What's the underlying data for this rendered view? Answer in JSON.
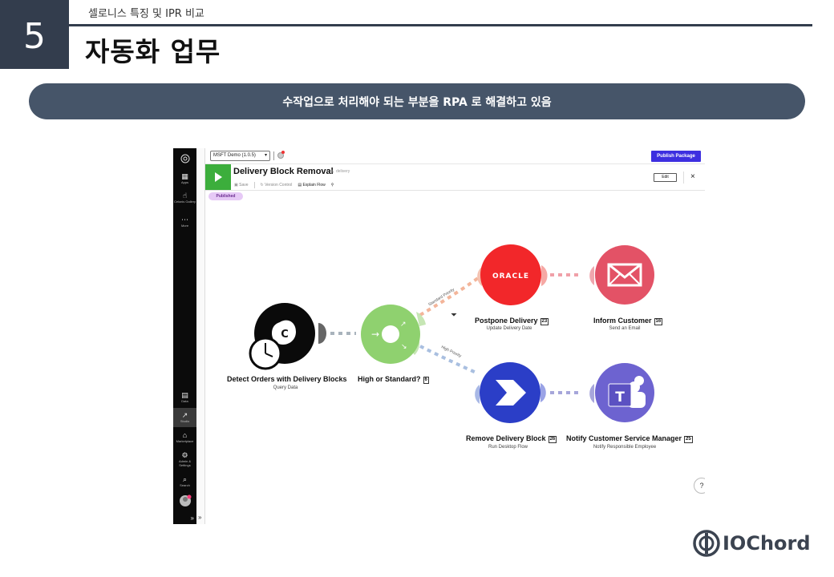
{
  "header": {
    "section_number": "5",
    "section_label": "셀로니스 특징 및 IPR 비교",
    "title": "자동화 업무"
  },
  "banner": {
    "text": "수작업으로 처리해야 되는 부분을 RPA 로 해결하고 있음"
  },
  "screenshot": {
    "sidebar": {
      "items": [
        {
          "icon": "apps-icon",
          "label": "Apps"
        },
        {
          "icon": "celonis-gallery-icon",
          "label": "Celonis Gallery"
        },
        {
          "icon": "more-icon",
          "label": "More"
        },
        {
          "icon": "data-icon",
          "label": "Data"
        },
        {
          "icon": "studio-icon",
          "label": "Studio"
        },
        {
          "icon": "marketplace-icon",
          "label": "Marketplace"
        },
        {
          "icon": "admin-settings-icon",
          "label": "Admin & Settings"
        },
        {
          "icon": "search-icon",
          "label": "Search"
        }
      ],
      "expand_glyph": "»"
    },
    "topbar": {
      "env_select": "MSFT Demo (1.0.5)",
      "publish_label": "Publish Package"
    },
    "flow": {
      "title": "Delivery Block Removal",
      "subtitle": "delivery",
      "toolbar": {
        "save": "Save",
        "version_control": "Version Control",
        "explain_flow": "Explain Flow"
      },
      "edit_label": "Edit",
      "close_glyph": "×",
      "status_badge": "Published"
    },
    "nodes": {
      "detect": {
        "title": "Detect Orders with Delivery Blocks",
        "subtitle": "Query Data",
        "glyph": "C"
      },
      "router": {
        "title": "High or Standard?",
        "badge": "6"
      },
      "postpone": {
        "title": "Postpone Delivery",
        "badge": "23",
        "subtitle": "Update Delivery Date",
        "brand": "ORACLE"
      },
      "inform": {
        "title": "Inform Customer",
        "badge": "16",
        "subtitle": "Send an Email"
      },
      "remove": {
        "title": "Remove Delivery Block",
        "badge": "26",
        "subtitle": "Run Desktop Flow"
      },
      "notify": {
        "title": "Notify Customer Service Manager",
        "badge": "25",
        "subtitle": "Notify Responsible Employee"
      }
    },
    "edges": {
      "standard": "Standard Priority",
      "high": "High Priority"
    },
    "colors": {
      "publish": "#3d2fe0",
      "play": "#3cae3c",
      "router": "#8fd16f",
      "oracle": "#f2272a",
      "email": "#e35266",
      "remove": "#2b3ec7",
      "teams": "#6d63d0"
    }
  },
  "logo": {
    "text": "IOChord"
  }
}
